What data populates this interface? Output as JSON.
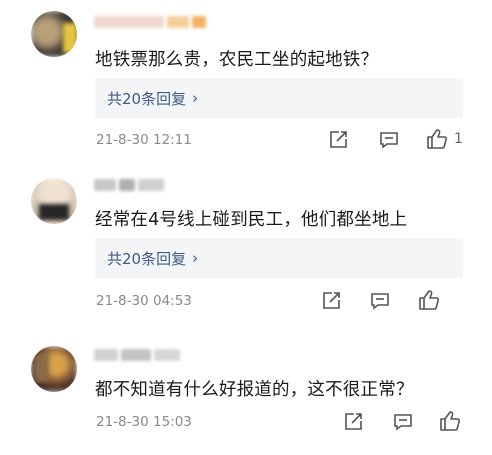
{
  "comments": [
    {
      "text": "地铁票那么贵，农民工坐的起地铁？",
      "reply": "共20条回复",
      "reply_chevron": "›",
      "time": "21-8-30 12:11",
      "likes": "1",
      "avatar_colors": [
        "#3a3530",
        "#b7a07a",
        "#e5c640",
        "#6a5a48"
      ]
    },
    {
      "text": "经常在4号线上碰到民工，他们都坐地上",
      "reply": "共20条回复",
      "reply_chevron": "›",
      "time": "21-8-30 04:53",
      "likes": "",
      "avatar_colors": [
        "#c9b8a4",
        "#efe2d2",
        "#262626",
        "#a38e76"
      ]
    },
    {
      "text": "都不知道有什么好报道的，这不很正常？",
      "reply": "",
      "reply_chevron": "",
      "time": "21-8-30 15:03",
      "likes": "",
      "avatar_colors": [
        "#5c3a2c",
        "#d9a24a",
        "#3b2a22",
        "#8a6c4a"
      ]
    }
  ],
  "icons": [
    "share-icon",
    "comment-icon",
    "like-icon"
  ]
}
